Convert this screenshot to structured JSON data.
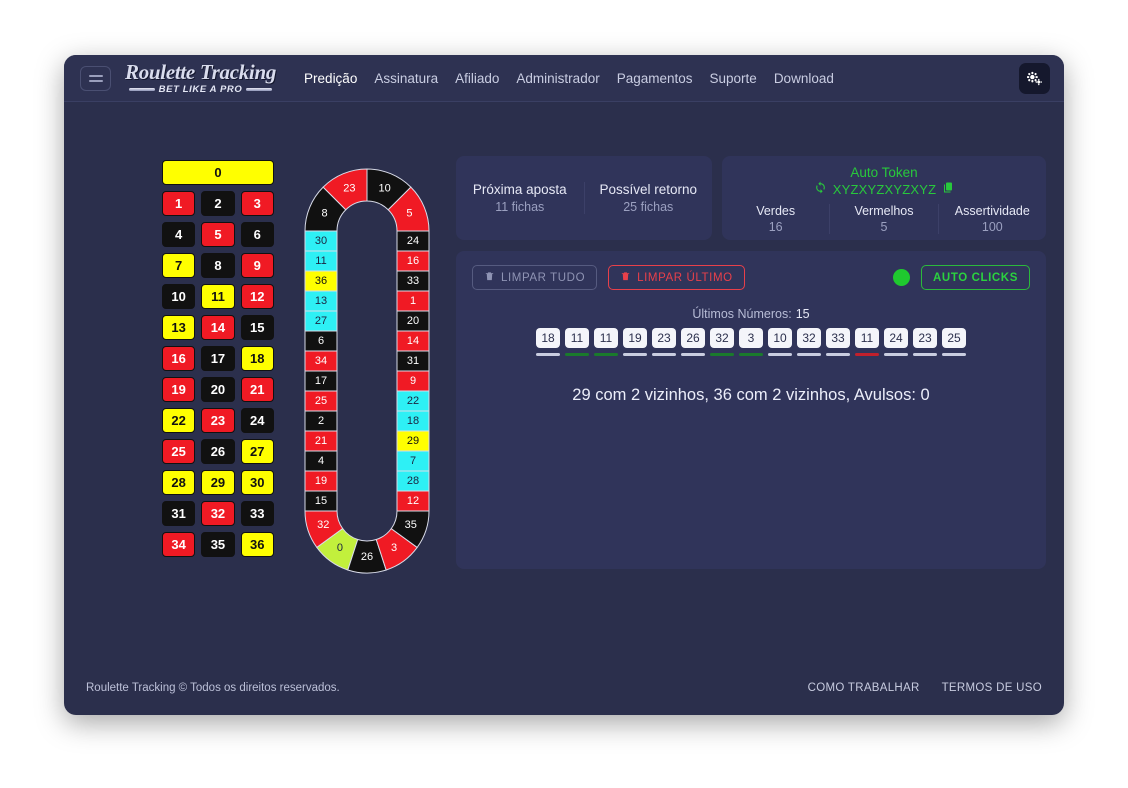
{
  "navbar": {
    "menu_icon": "hamburger-icon",
    "brand_main": "Roulette Tracking",
    "brand_sub": "BET LIKE A PRO",
    "links": [
      {
        "label": "Predição",
        "active": true
      },
      {
        "label": "Assinatura",
        "active": false
      },
      {
        "label": "Afiliado",
        "active": false
      },
      {
        "label": "Administrador",
        "active": false
      },
      {
        "label": "Pagamentos",
        "active": false
      },
      {
        "label": "Suporte",
        "active": false
      },
      {
        "label": "Download",
        "active": false
      }
    ],
    "settings_icon": "gears-icon"
  },
  "number_grid": {
    "zero": {
      "label": "0",
      "color": "yellow"
    },
    "rows": [
      [
        {
          "label": "1",
          "color": "red"
        },
        {
          "label": "2",
          "color": "black"
        },
        {
          "label": "3",
          "color": "red"
        }
      ],
      [
        {
          "label": "4",
          "color": "black"
        },
        {
          "label": "5",
          "color": "red"
        },
        {
          "label": "6",
          "color": "black"
        }
      ],
      [
        {
          "label": "7",
          "color": "yellow"
        },
        {
          "label": "8",
          "color": "black"
        },
        {
          "label": "9",
          "color": "red"
        }
      ],
      [
        {
          "label": "10",
          "color": "black"
        },
        {
          "label": "11",
          "color": "yellow"
        },
        {
          "label": "12",
          "color": "red"
        }
      ],
      [
        {
          "label": "13",
          "color": "yellow"
        },
        {
          "label": "14",
          "color": "red"
        },
        {
          "label": "15",
          "color": "black"
        }
      ],
      [
        {
          "label": "16",
          "color": "red"
        },
        {
          "label": "17",
          "color": "black"
        },
        {
          "label": "18",
          "color": "yellow"
        }
      ],
      [
        {
          "label": "19",
          "color": "red"
        },
        {
          "label": "20",
          "color": "black"
        },
        {
          "label": "21",
          "color": "red"
        }
      ],
      [
        {
          "label": "22",
          "color": "yellow"
        },
        {
          "label": "23",
          "color": "red"
        },
        {
          "label": "24",
          "color": "black"
        }
      ],
      [
        {
          "label": "25",
          "color": "red"
        },
        {
          "label": "26",
          "color": "black"
        },
        {
          "label": "27",
          "color": "yellow"
        }
      ],
      [
        {
          "label": "28",
          "color": "yellow"
        },
        {
          "label": "29",
          "color": "yellow"
        },
        {
          "label": "30",
          "color": "yellow"
        }
      ],
      [
        {
          "label": "31",
          "color": "black"
        },
        {
          "label": "32",
          "color": "red"
        },
        {
          "label": "33",
          "color": "black"
        }
      ],
      [
        {
          "label": "34",
          "color": "red"
        },
        {
          "label": "35",
          "color": "black"
        },
        {
          "label": "36",
          "color": "yellow"
        }
      ]
    ]
  },
  "racetrack": {
    "top_arc": [
      {
        "label": "8",
        "color": "black"
      },
      {
        "label": "23",
        "color": "red"
      },
      {
        "label": "10",
        "color": "black"
      },
      {
        "label": "5",
        "color": "red"
      }
    ],
    "left_column": [
      {
        "label": "30",
        "color": "cyan"
      },
      {
        "label": "11",
        "color": "cyan"
      },
      {
        "label": "36",
        "color": "yellow"
      },
      {
        "label": "13",
        "color": "cyan"
      },
      {
        "label": "27",
        "color": "cyan"
      },
      {
        "label": "6",
        "color": "black"
      },
      {
        "label": "34",
        "color": "red"
      },
      {
        "label": "17",
        "color": "black"
      },
      {
        "label": "25",
        "color": "red"
      },
      {
        "label": "2",
        "color": "black"
      },
      {
        "label": "21",
        "color": "red"
      },
      {
        "label": "4",
        "color": "black"
      },
      {
        "label": "19",
        "color": "red"
      },
      {
        "label": "15",
        "color": "black"
      }
    ],
    "right_column": [
      {
        "label": "24",
        "color": "black"
      },
      {
        "label": "16",
        "color": "red"
      },
      {
        "label": "33",
        "color": "black"
      },
      {
        "label": "1",
        "color": "red"
      },
      {
        "label": "20",
        "color": "black"
      },
      {
        "label": "14",
        "color": "red"
      },
      {
        "label": "31",
        "color": "black"
      },
      {
        "label": "9",
        "color": "red"
      },
      {
        "label": "22",
        "color": "cyan"
      },
      {
        "label": "18",
        "color": "cyan"
      },
      {
        "label": "29",
        "color": "yellow"
      },
      {
        "label": "7",
        "color": "cyan"
      },
      {
        "label": "28",
        "color": "cyan"
      },
      {
        "label": "12",
        "color": "red"
      }
    ],
    "bottom_arc": [
      {
        "label": "32",
        "color": "red"
      },
      {
        "label": "0",
        "color": "green"
      },
      {
        "label": "26",
        "color": "black"
      },
      {
        "label": "3",
        "color": "red"
      },
      {
        "label": "35",
        "color": "black"
      }
    ]
  },
  "bets_card": {
    "next_bet_label": "Próxima aposta",
    "next_bet_value": "11 fichas",
    "return_label": "Possível retorno",
    "return_value": "25 fichas"
  },
  "token_card": {
    "title": "Auto Token",
    "refresh_icon": "refresh-icon",
    "code": "XYZXYZXYZXYZ",
    "copy_icon": "copy-icon",
    "stats": [
      {
        "label": "Verdes",
        "value": "16"
      },
      {
        "label": "Vermelhos",
        "value": "5"
      },
      {
        "label": "Assertividade",
        "value": "100"
      }
    ]
  },
  "actions": {
    "clear_all_label": "LIMPAR TUDO",
    "clear_all_icon": "trash-icon",
    "clear_last_label": "LIMPAR ÚLTIMO",
    "clear_last_icon": "trash-icon",
    "status_dot": "status-indicator",
    "auto_clicks_label": "AUTO CLICKS"
  },
  "last_numbers": {
    "title": "Últimos Números:",
    "count": "15",
    "items": [
      {
        "value": "18",
        "bar": "grey"
      },
      {
        "value": "11",
        "bar": "green"
      },
      {
        "value": "11",
        "bar": "green"
      },
      {
        "value": "19",
        "bar": "grey"
      },
      {
        "value": "23",
        "bar": "grey"
      },
      {
        "value": "26",
        "bar": "grey"
      },
      {
        "value": "32",
        "bar": "green"
      },
      {
        "value": "3",
        "bar": "green"
      },
      {
        "value": "10",
        "bar": "grey"
      },
      {
        "value": "32",
        "bar": "grey"
      },
      {
        "value": "33",
        "bar": "grey"
      },
      {
        "value": "11",
        "bar": "red"
      },
      {
        "value": "24",
        "bar": "grey"
      },
      {
        "value": "23",
        "bar": "grey"
      },
      {
        "value": "25",
        "bar": "grey"
      }
    ]
  },
  "prediction_text": "29 com 2 vizinhos, 36 com 2 vizinhos, Avulsos: 0",
  "footer": {
    "copyright": "Roulette Tracking  © Todos os direitos reservados.",
    "links": [
      "COMO TRABALHAR",
      "TERMOS DE USO"
    ]
  },
  "colors": {
    "page_bg": "#2b2f4c",
    "nav_bg": "#2e3252",
    "card_bg": "#30345a",
    "red": "#f01a24",
    "black": "#111111",
    "yellow": "#ffff00",
    "cyan": "#2ef0f5",
    "green": "#c2f03c",
    "accent_green": "#28c83c"
  }
}
